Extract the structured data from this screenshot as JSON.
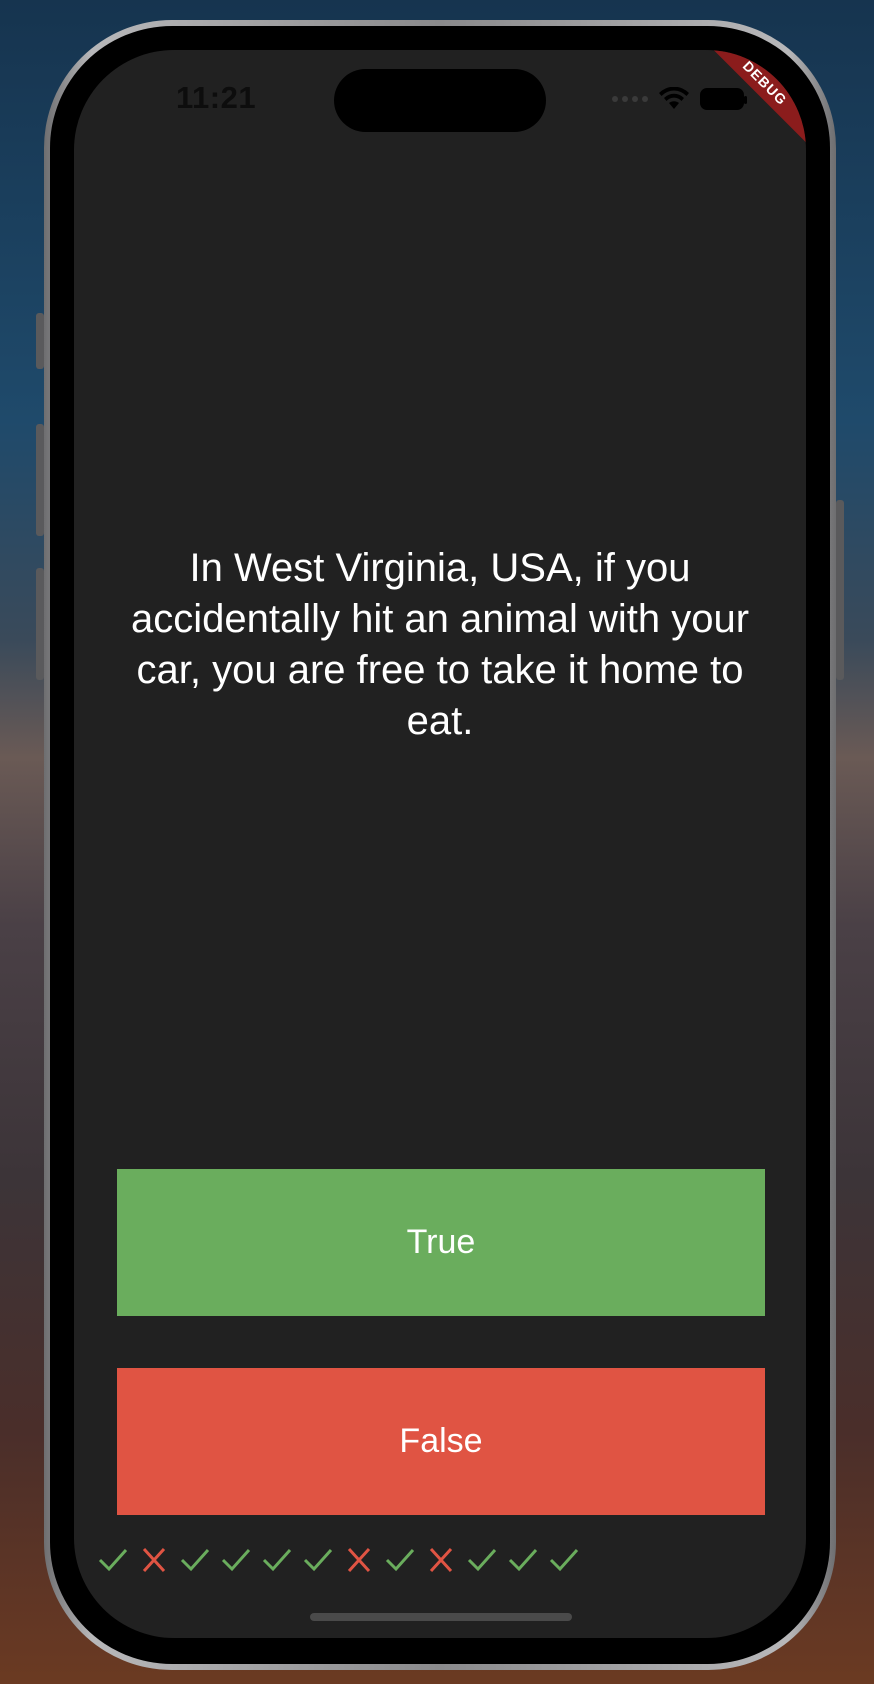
{
  "status_bar": {
    "time": "11:21"
  },
  "debug_banner": "DEBUG",
  "question": "In West Virginia, USA, if you accidentally hit an animal with your car, you are free to take it home to eat.",
  "buttons": {
    "true_label": "True",
    "false_label": "False"
  },
  "colors": {
    "true": "#6aad5d",
    "false": "#e05443",
    "background": "#212121",
    "check": "#6aad5d",
    "cross": "#e05443"
  },
  "score_keeper": [
    "check",
    "cross",
    "check",
    "check",
    "check",
    "check",
    "cross",
    "check",
    "cross",
    "check",
    "check",
    "check"
  ]
}
